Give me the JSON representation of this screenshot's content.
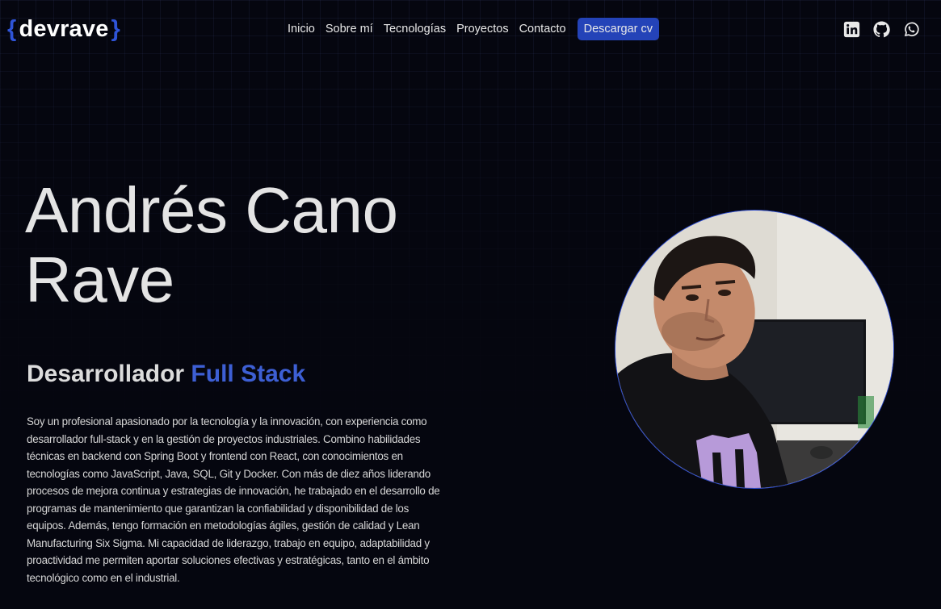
{
  "header": {
    "logo_open": "{",
    "logo_text": "devrave",
    "logo_close": "}",
    "nav": [
      {
        "label": "Inicio"
      },
      {
        "label": "Sobre mí"
      },
      {
        "label": "Tecnologías"
      },
      {
        "label": "Proyectos"
      },
      {
        "label": "Contacto"
      }
    ],
    "cv_button": "Descargar cv",
    "socials": [
      "linkedin-icon",
      "github-icon",
      "whatsapp-icon"
    ]
  },
  "hero": {
    "name_line1": "Andrés Cano",
    "name_line2": "Rave",
    "role_prefix": "Desarrollador",
    "role_accent": "Full Stack",
    "bio": "Soy un profesional apasionado por la tecnología y la innovación, con experiencia como desarrollador full-stack y en la gestión de proyectos industriales. Combino habilidades técnicas en backend con Spring Boot y frontend con React, con conocimientos en tecnologías como JavaScript, Java, SQL, Git y Docker. Con más de diez años liderando procesos de mejora continua y estrategias de innovación, he trabajado en el desarrollo de programas de mantenimiento que garantizan la confiabilidad y disponibilidad de los equipos. Además, tengo formación en metodologías ágiles, gestión de calidad y Lean Manufacturing Six Sigma. Mi capacidad de liderazgo, trabajo en equipo, adaptabilidad y proactividad me permiten aportar soluciones efectivas y estratégicas, tanto en el ámbito tecnológico como en el industrial."
  },
  "colors": {
    "background": "#05060f",
    "accent": "#2443b8",
    "accent_text": "#3d5fd4"
  }
}
